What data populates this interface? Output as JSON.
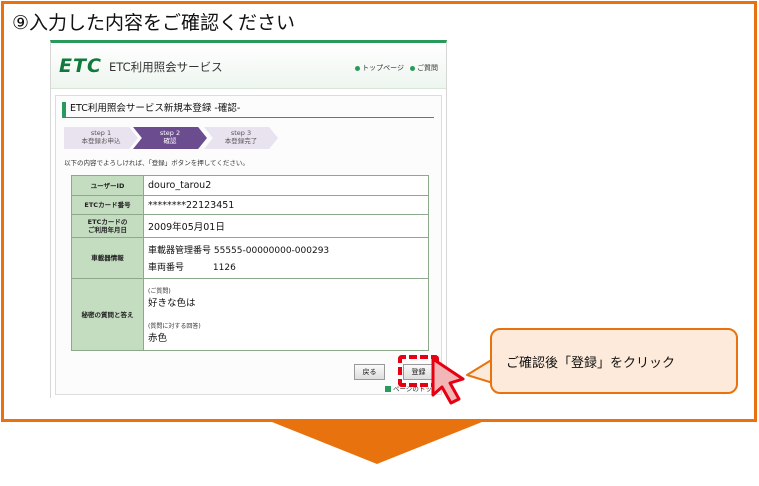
{
  "heading": "⑨入力した内容をご確認ください",
  "app": {
    "logo": "ETC",
    "service_name": "ETC利用照会サービス",
    "links": [
      "トップページ",
      "ご質問"
    ]
  },
  "form": {
    "title": "ETC利用照会サービス新規本登録 -確認-",
    "steps": [
      {
        "num": "step 1",
        "label": "本登録お申込"
      },
      {
        "num": "step 2",
        "label": "確認"
      },
      {
        "num": "step 3",
        "label": "本登録完了"
      }
    ],
    "instruction": "以下の内容でよろしければ、「登録」ボタンを押してください。",
    "rows": {
      "user_id": {
        "label": "ユーザーID",
        "value": "douro_tarou2"
      },
      "card_number": {
        "label": "ETCカード番号",
        "value": "********22123451"
      },
      "card_date": {
        "label_line1": "ETCカードの",
        "label_line2": "ご利用年月日",
        "value": "2009年05月01日"
      },
      "vehicle": {
        "label": "車載器情報",
        "line1": "車載器管理番号 55555-00000000-000293",
        "line2_label": "車両番号",
        "line2_value": "1126"
      },
      "secret": {
        "label": "秘密の質問と答え",
        "question_caption": "(ご質問)",
        "question": "好きな色は",
        "answer_caption": "(質問に対する回答)",
        "answer": "赤色"
      }
    },
    "back_label": "戻る",
    "register_label": "登録",
    "page_top_label": "ページのトップへ"
  },
  "callout": "ご確認後「登録」をクリック",
  "colors": {
    "frame": "#e8730e",
    "brand_green": "#2a9a5c",
    "step_active": "#6b4d8f",
    "highlight": "#e60012",
    "callout_bg": "#fdeada"
  }
}
